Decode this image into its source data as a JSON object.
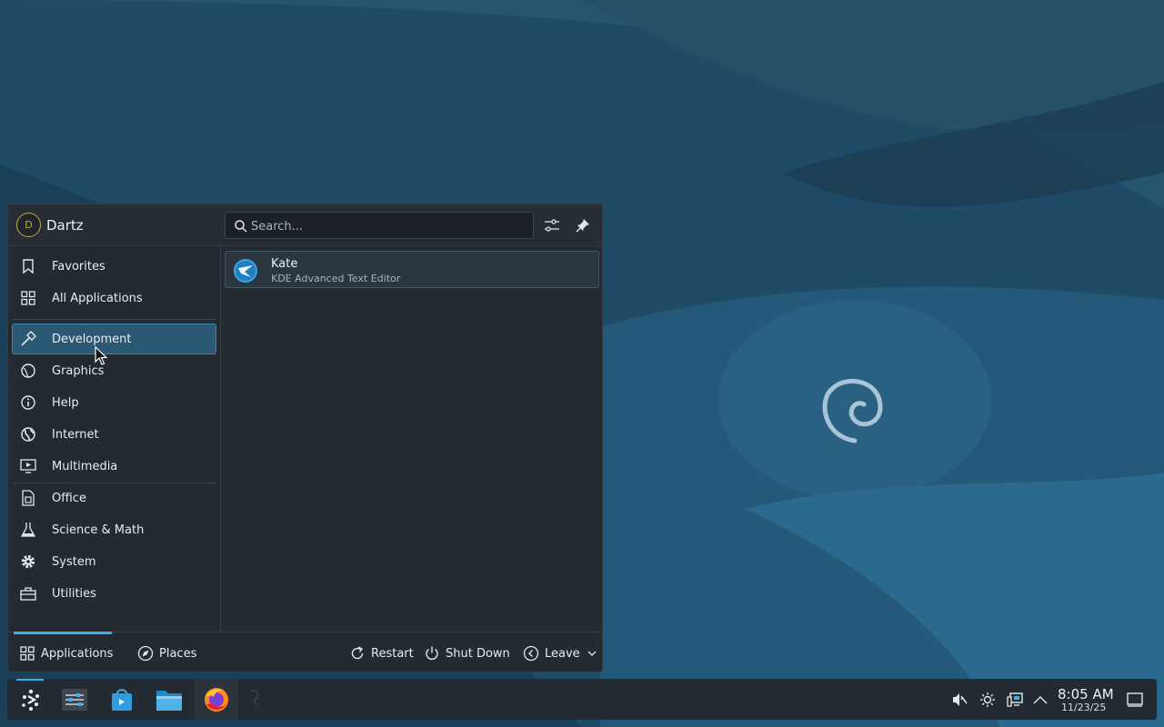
{
  "user": {
    "initial": "D",
    "name": "Dartz"
  },
  "search": {
    "placeholder": "Search..."
  },
  "header_icons": [
    "configure-icon",
    "pin-icon"
  ],
  "categories": [
    {
      "label": "Favorites",
      "icon": "bookmark-icon"
    },
    {
      "label": "All Applications",
      "icon": "grid-icon"
    },
    {
      "label": "Development",
      "icon": "hammer-icon",
      "active": true
    },
    {
      "label": "Graphics",
      "icon": "palette-icon"
    },
    {
      "label": "Help",
      "icon": "info-icon"
    },
    {
      "label": "Internet",
      "icon": "globe-icon"
    },
    {
      "label": "Multimedia",
      "icon": "media-icon"
    },
    {
      "label": "Office",
      "icon": "document-icon"
    },
    {
      "label": "Science & Math",
      "icon": "flask-icon"
    },
    {
      "label": "System",
      "icon": "gear-icon"
    },
    {
      "label": "Utilities",
      "icon": "toolbox-icon"
    }
  ],
  "results": [
    {
      "name": "Kate",
      "description": "KDE Advanced Text Editor",
      "icon": "kate-icon"
    }
  ],
  "footer": {
    "tabs": [
      "Applications",
      "Places"
    ],
    "actions": [
      "Restart",
      "Shut Down",
      "Leave"
    ]
  },
  "taskbar": {
    "apps": [
      "kde-launcher-icon",
      "system-settings-icon",
      "discover-icon",
      "dolphin-icon",
      "firefox-icon"
    ],
    "tray": [
      "volume-muted-icon",
      "brightness-icon",
      "network-icon",
      "tray-expand-icon",
      "show-desktop-icon"
    ],
    "time": "8:05 AM",
    "date": "11/23/25"
  },
  "colors": {
    "accent": "#3daee9",
    "panel": "#232a31",
    "wallpaper": "#1f4d68"
  }
}
